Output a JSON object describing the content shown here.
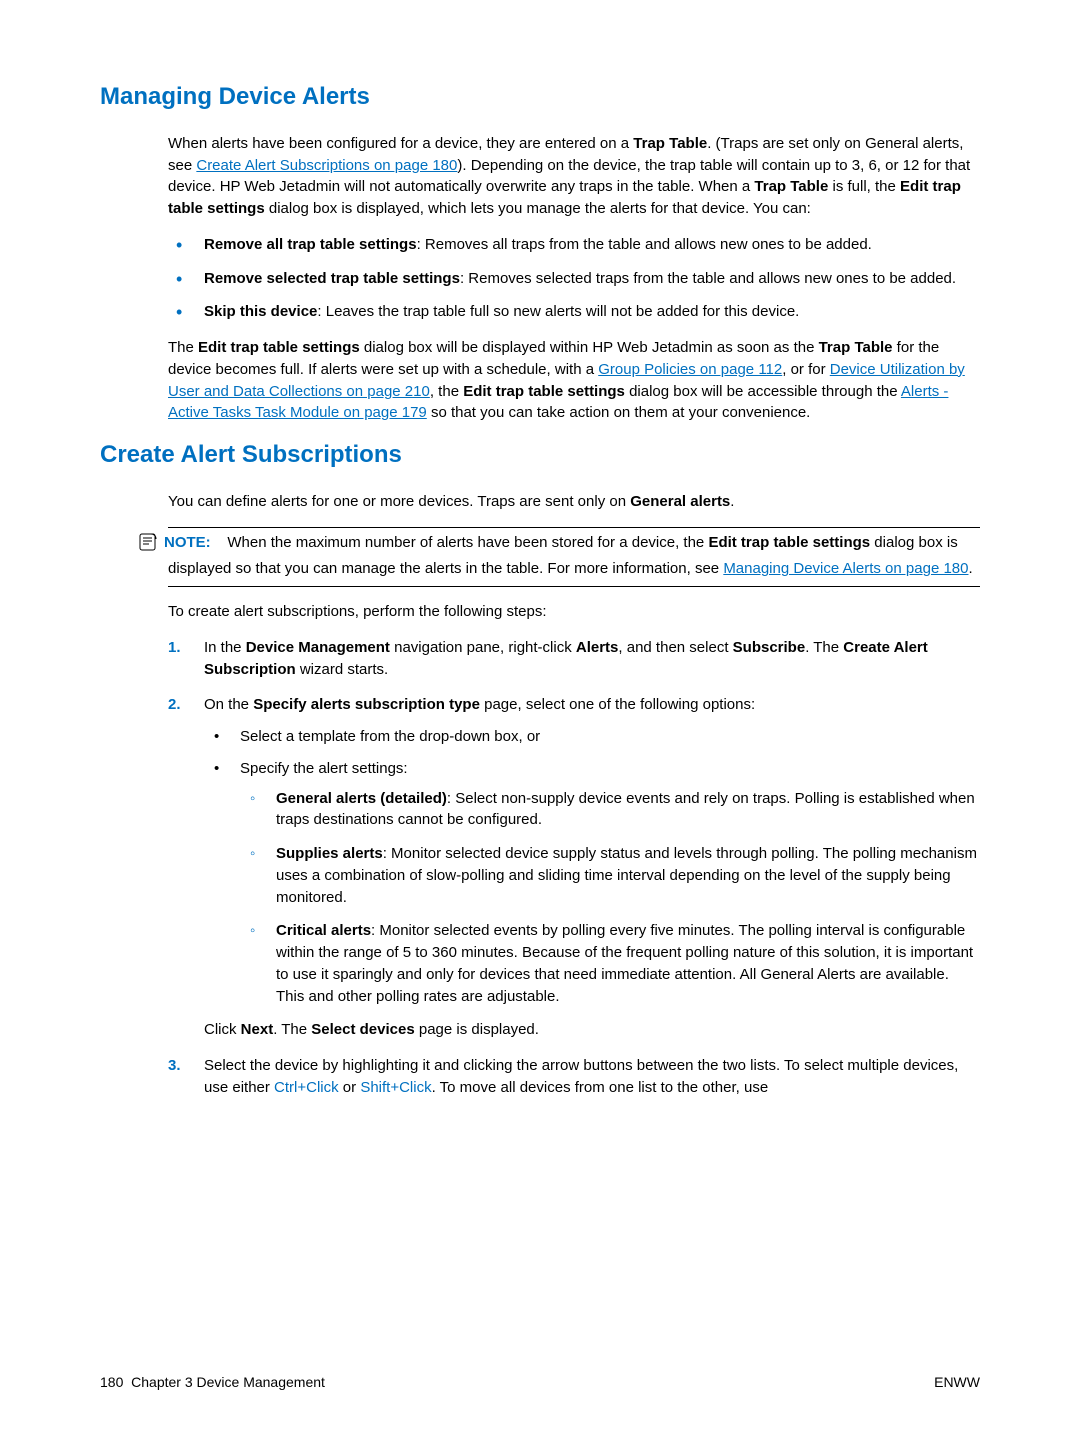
{
  "section1": {
    "heading": "Managing Device Alerts",
    "p1_a": "When alerts have been configured for a device, they are entered on a ",
    "p1_b": "Trap Table",
    "p1_c": ". (Traps are set only on General alerts, see ",
    "p1_link1": "Create Alert Subscriptions on page 180",
    "p1_d": "). Depending on the device, the trap table will contain up to 3, 6, or 12 for that device. HP Web Jetadmin will not automatically overwrite any traps in the table. When a ",
    "p1_e": "Trap Table",
    "p1_f": " is full, the ",
    "p1_g": "Edit trap table settings",
    "p1_h": " dialog box is displayed, which lets you manage the alerts for that device. You can:",
    "b1_a": "Remove all trap table settings",
    "b1_b": ": Removes all traps from the table and allows new ones to be added.",
    "b2_a": "Remove selected trap table settings",
    "b2_b": ": Removes selected traps from the table and allows new ones to be added.",
    "b3_a": "Skip this device",
    "b3_b": ": Leaves the trap table full so new alerts will not be added for this device.",
    "p2_a": "The ",
    "p2_b": "Edit trap table settings",
    "p2_c": " dialog box will be displayed within HP Web Jetadmin as soon as the ",
    "p2_d": "Trap Table",
    "p2_e": " for the device becomes full. If alerts were set up with a schedule, with a ",
    "p2_link2": "Group Policies on page 112",
    "p2_f": ", or for ",
    "p2_link3": "Device Utilization by User and Data Collections on page 210",
    "p2_g": ", the ",
    "p2_h": "Edit trap table settings",
    "p2_i": " dialog box will be accessible through the ",
    "p2_link4": "Alerts - Active Tasks Task Module on page 179",
    "p2_j": " so that you can take action on them at your convenience."
  },
  "section2": {
    "heading": "Create Alert Subscriptions",
    "p1_a": "You can define alerts for one or more devices. Traps are sent only on ",
    "p1_b": "General alerts",
    "p1_c": ".",
    "note_label": "NOTE:",
    "note_a": "When the maximum number of alerts have been stored for a device, the ",
    "note_b": "Edit trap table settings",
    "note_c": " dialog box is displayed so that you can manage the alerts in the table. For more information, see ",
    "note_link": "Managing Device Alerts on page 180",
    "note_d": ".",
    "p2": "To create alert subscriptions, perform the following steps:",
    "s1_a": "In the ",
    "s1_b": "Device Management",
    "s1_c": " navigation pane, right-click ",
    "s1_d": "Alerts",
    "s1_e": ", and then select ",
    "s1_f": "Subscribe",
    "s1_g": ". The ",
    "s1_h": "Create Alert Subscription",
    "s1_i": " wizard starts.",
    "s2_a": "On the ",
    "s2_b": "Specify alerts subscription type",
    "s2_c": " page, select one of the following options:",
    "s2_sub1": "Select a template from the drop-down box, or",
    "s2_sub2": "Specify the alert settings:",
    "s2_o1_a": "General alerts (detailed)",
    "s2_o1_b": ": Select non-supply device events and rely on traps. Polling is established when traps destinations cannot be configured.",
    "s2_o2_a": "Supplies alerts",
    "s2_o2_b": ": Monitor selected device supply status and levels through polling. The polling mechanism uses a combination of slow-polling and sliding time interval depending on the level of the supply being monitored.",
    "s2_o3_a": "Critical alerts",
    "s2_o3_b": ": Monitor selected events by polling every five minutes. The polling interval is configurable within the range of 5 to 360 minutes. Because of the frequent polling nature of this solution, it is important to use it sparingly and only for devices that need immediate attention. All General Alerts are available. This and other polling rates are adjustable.",
    "s2_end_a": "Click ",
    "s2_end_b": "Next",
    "s2_end_c": ". The ",
    "s2_end_d": "Select devices",
    "s2_end_e": " page is displayed.",
    "s3_a": "Select the device by highlighting it and clicking the arrow buttons between the two lists. To select multiple devices, use either ",
    "s3_k1": "Ctrl+Click",
    "s3_b": " or ",
    "s3_k2": "Shift+Click",
    "s3_c": ". To move all devices from one list to the other, use"
  },
  "steps": {
    "n1": "1.",
    "n2": "2.",
    "n3": "3."
  },
  "footer": {
    "left_a": "180",
    "left_b": "Chapter 3   Device Management",
    "right": "ENWW"
  }
}
